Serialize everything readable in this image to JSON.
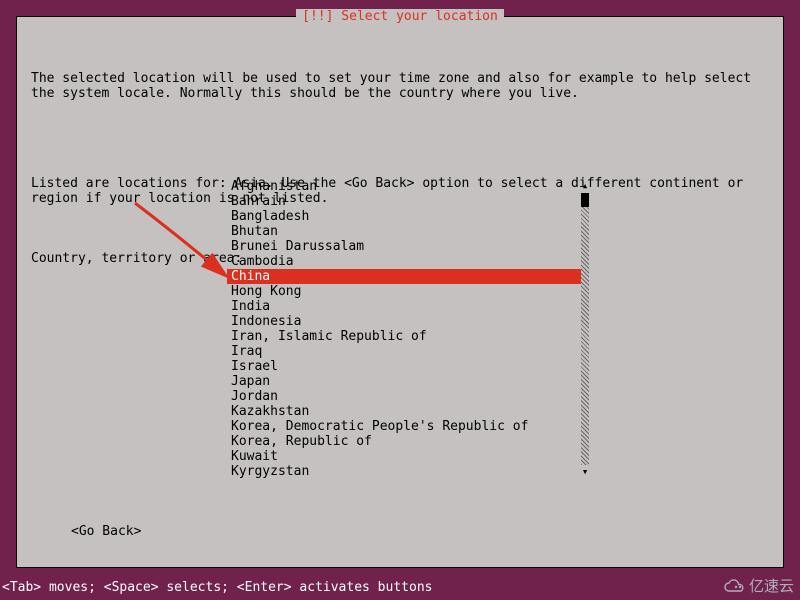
{
  "dialog": {
    "title": "[!!] Select your location",
    "paragraph1": "The selected location will be used to set your time zone and also for example to help select the system locale. Normally this should be the country where you live.",
    "paragraph2": "Listed are locations for: Asia. Use the <Go Back> option to select a different continent or region if your location is not listed.",
    "prompt": "Country, territory or area:",
    "go_back": "<Go Back>"
  },
  "list": {
    "items": [
      "Afghanistan",
      "Bahrain",
      "Bangladesh",
      "Bhutan",
      "Brunei Darussalam",
      "Cambodia",
      "China",
      "Hong Kong",
      "India",
      "Indonesia",
      "Iran, Islamic Republic of",
      "Iraq",
      "Israel",
      "Japan",
      "Jordan",
      "Kazakhstan",
      "Korea, Democratic People's Republic of",
      "Korea, Republic of",
      "Kuwait",
      "Kyrgyzstan"
    ],
    "selected_index": 6
  },
  "helpbar": "<Tab> moves; <Space> selects; <Enter> activates buttons",
  "watermark": "亿速云",
  "colors": {
    "background": "#70224c",
    "panel": "#c5c1c1",
    "accent": "#d9301f"
  }
}
